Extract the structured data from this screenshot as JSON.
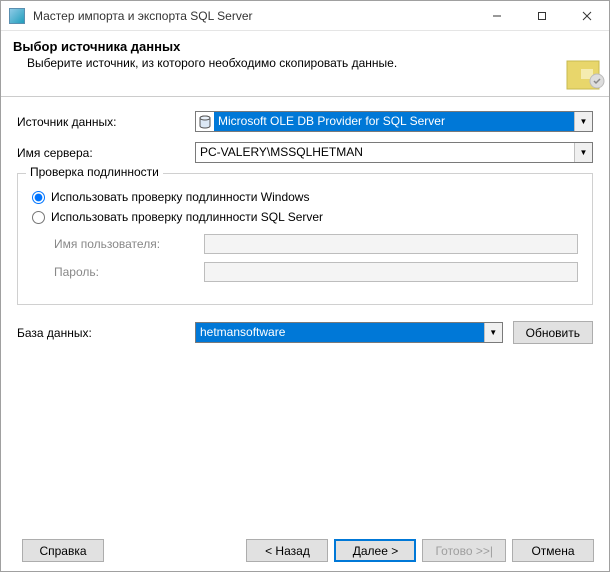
{
  "window": {
    "title": "Мастер импорта и экспорта SQL Server"
  },
  "header": {
    "title": "Выбор источника данных",
    "description": "Выберите источник, из которого необходимо скопировать данные."
  },
  "labels": {
    "data_source": "Источник данных:",
    "server_name": "Имя сервера:",
    "auth_group": "Проверка подлинности",
    "auth_windows": "Использовать проверку подлинности Windows",
    "auth_sql": "Использовать проверку подлинности SQL Server",
    "username": "Имя пользователя:",
    "password": "Пароль:",
    "database": "База данных:"
  },
  "values": {
    "data_source": "Microsoft OLE DB Provider for SQL Server",
    "server_name": "PC-VALERY\\MSSQLHETMAN",
    "username": "",
    "password": "",
    "database": "hetmansoftware",
    "auth_mode": "windows"
  },
  "buttons": {
    "refresh": "Обновить",
    "help": "Справка",
    "back": "< Назад",
    "next": "Далее >",
    "finish": "Готово >>|",
    "cancel": "Отмена"
  }
}
